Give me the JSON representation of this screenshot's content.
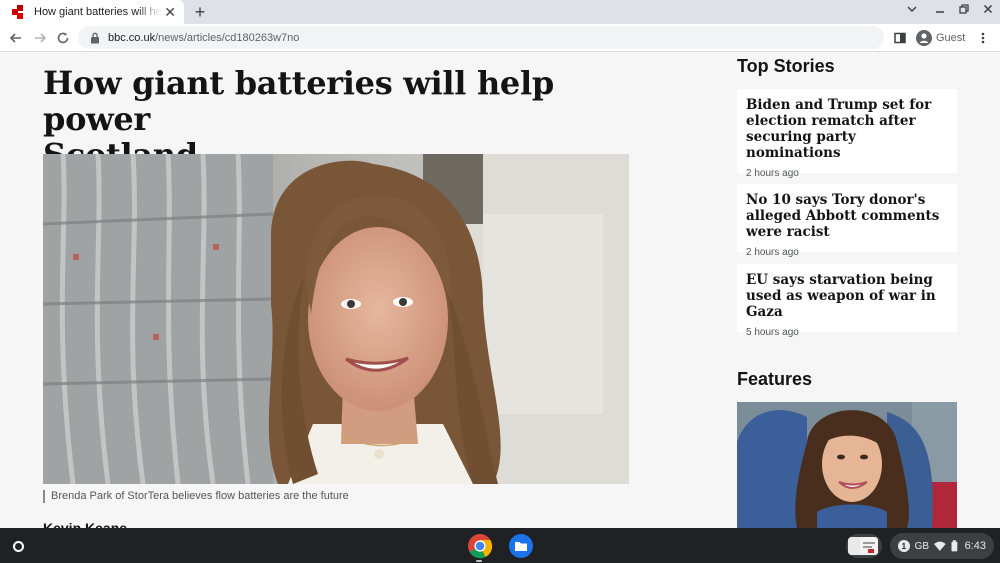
{
  "browser": {
    "tab": {
      "title": "How giant batteries will help power Scotland"
    },
    "url": {
      "host": "bbc.co.uk",
      "path": "/news/articles/cd180263w7no"
    },
    "profile": {
      "label": "Guest"
    }
  },
  "article": {
    "headline_line1": "How giant batteries will help power",
    "headline_line2": "Scotland",
    "hero_caption": "Brenda Park of StorTera believes flow batteries are the future",
    "author": "Kevin Keane"
  },
  "sidebar": {
    "top_stories_title": "Top Stories",
    "stories": [
      {
        "title": "Biden and Trump set for election rematch after securing party nominations",
        "time": "2 hours ago"
      },
      {
        "title": "No 10 says Tory donor's alleged Abbott comments were racist",
        "time": "2 hours ago"
      },
      {
        "title": "EU says starvation being used as weapon of war in Gaza",
        "time": "5 hours ago"
      }
    ],
    "features_title": "Features"
  },
  "shelf": {
    "tray": {
      "notification_count": "1",
      "region": "GB",
      "time": "6:43"
    }
  },
  "colors": {
    "bbc_red": "#b80000",
    "headline": "#141414",
    "page_bg": "#f6f6f6",
    "shelf_bg": "#202124"
  }
}
